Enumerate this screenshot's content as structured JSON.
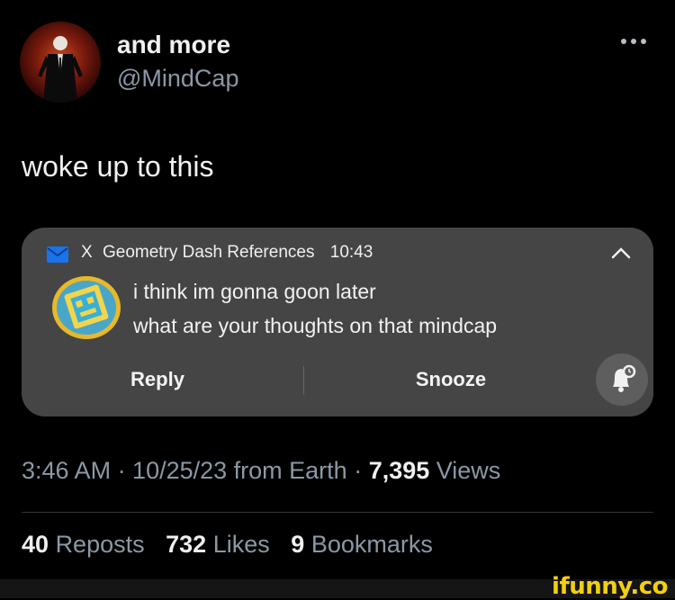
{
  "author": {
    "display_name": "and more",
    "handle": "@MindCap"
  },
  "tweet": {
    "text": "woke up to this",
    "timestamp": "3:46 AM · 10/25/23 from Earth · ",
    "views_count": "7,395",
    "views_label": " Views"
  },
  "notification": {
    "app_name": "X",
    "sender": "Geometry Dash References",
    "time": "10:43",
    "line1": "i think im gonna goon later",
    "line2": "what are your thoughts on that mindcap",
    "reply_label": "Reply",
    "snooze_label": "Snooze",
    "icons": {
      "app": "mail-icon",
      "collapse": "chevron-up-icon",
      "avatar": "geometry-dash-icon",
      "bell": "bell-snooze-icon"
    }
  },
  "engagement": {
    "reposts_count": "40",
    "reposts_label": "Reposts",
    "likes_count": "732",
    "likes_label": "Likes",
    "bookmarks_count": "9",
    "bookmarks_label": "Bookmarks"
  },
  "watermark": "ifunny.co",
  "colors": {
    "background": "#000000",
    "notification_bg": "#454545",
    "secondary_text": "#8b98a5",
    "mail_blue": "#1a73e8",
    "watermark_yellow": "#f3cf10"
  }
}
